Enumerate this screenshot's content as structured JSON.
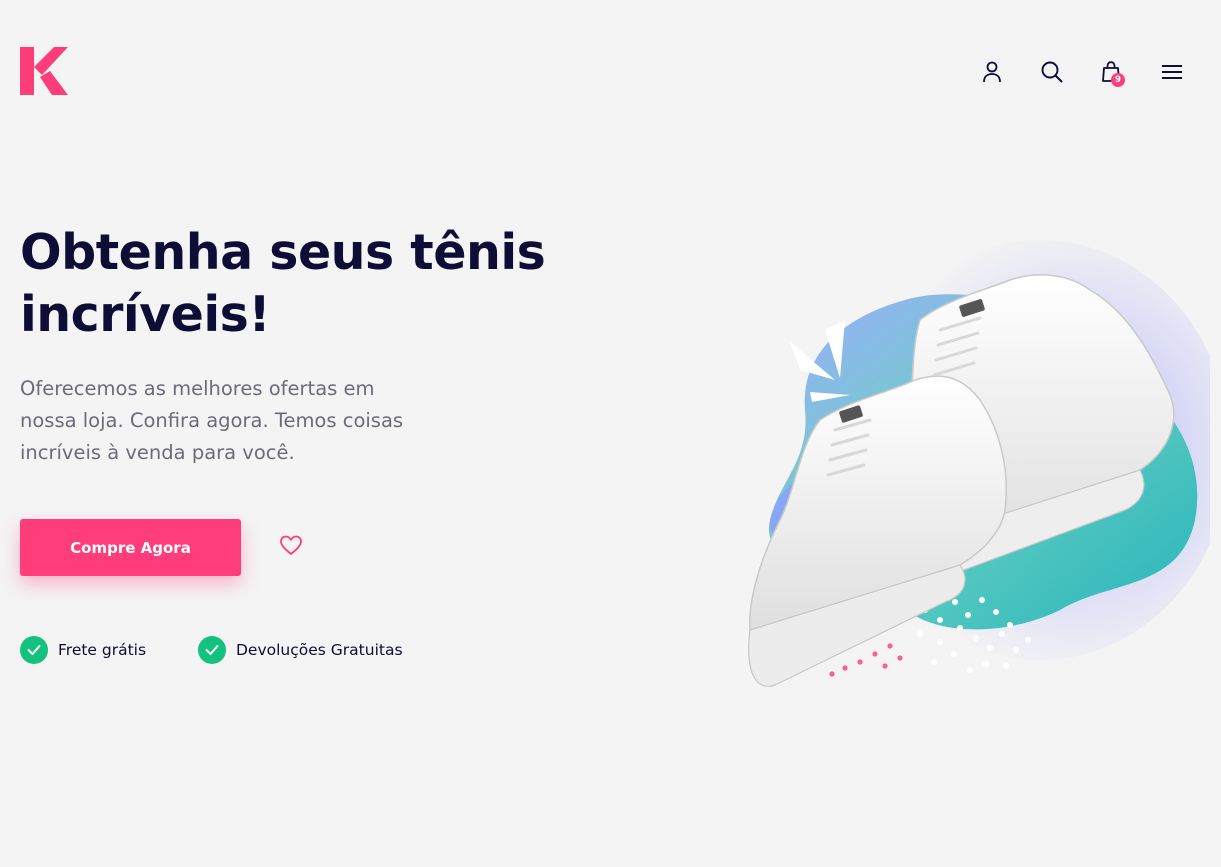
{
  "header": {
    "logo_letter": "K",
    "icons": [
      "user-icon",
      "search-icon",
      "shopping-bag-icon",
      "menu-icon"
    ],
    "cart_count": "9"
  },
  "hero": {
    "title": "Obtenha seus tênis incríveis!",
    "description": "Oferecemos as melhores ofertas em nossa loja. Confira agora. Temos coisas incríveis à venda para você.",
    "cta_label": "Compre Agora",
    "features": [
      {
        "label": "Frete grátis"
      },
      {
        "label": "Devoluções Gratuitas"
      }
    ]
  },
  "colors": {
    "accent": "#ff3d7a",
    "text_dark": "#0d0d36",
    "text_muted": "#6b6b7a",
    "success": "#13c27f",
    "background": "#f4f4f4"
  }
}
